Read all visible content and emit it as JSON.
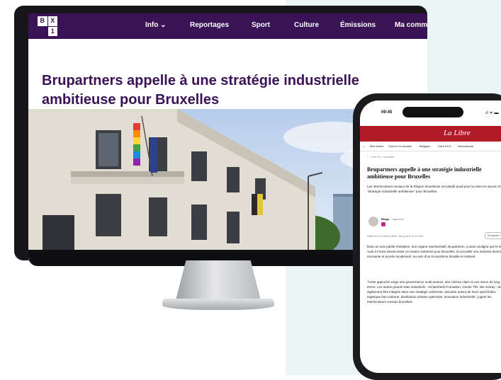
{
  "desktop": {
    "site_logo": [
      "B",
      "X",
      "1"
    ],
    "nav": [
      "Info ⌄",
      "Reportages",
      "Sport",
      "Culture",
      "Émissions",
      "Ma commu"
    ],
    "headline": "Brupartners appelle à une stratégie industrielle ambitieuse pour Bruxelles"
  },
  "phone": {
    "status_time": "09:45",
    "status_icons": ".ıl ᯤ ▬",
    "brand": "La Libre",
    "subnav": [
      "Mes séries",
      "Guerre en Ukraine",
      "Belgique",
      "Libre ECO",
      "International"
    ],
    "breadcrumb": "⌂ · Libre Eco · Actualités",
    "title": "Brupartners appelle à une stratégie industrielle ambitieuse pour Bruxelles",
    "lead": "Les interlocuteurs sociaux de la Région bruxelloise ont plaidé jeudi pour la mise en œuvre d'une \"stratégie industrielle ambitieuse\" pour Bruxelles.",
    "author": "Belga",
    "agency": "Agences",
    "date": "Publié le 02-10-2025 à 15h05 - Mis à jour le 02-10-2025",
    "save_label": "Enregistrer",
    "body_1": "Dans un avis publié d'initiative, leur organe représentatif, Brupartners, a ainsi souligné que le site Audi à Forest devait rester un moteur industriel pour Bruxelles, et accueillir une industrie diversifiée, innovante et ancrée localement, au sein d'un écosystème durable et résilient.",
    "body_2": "\"Cette approche exige une gouvernance multi-acteurs, des critères clairs et une vision de long terme. Les autres grands sites industriels - Schaerbeek-Formation, Centre TIR, site Solvay - doivent également être intégrés dans une stratégie cohérente, articulée autour de leurs spécificités: logistique bas-carbone, distribution urbaine optimisée, innovation industrielle\", jugent les interlocuteurs sociaux bruxellois."
  },
  "colors": {
    "bx_purple": "#3a1357",
    "lalibre_red": "#b01b26",
    "background_mint": "#e9f5f4"
  }
}
